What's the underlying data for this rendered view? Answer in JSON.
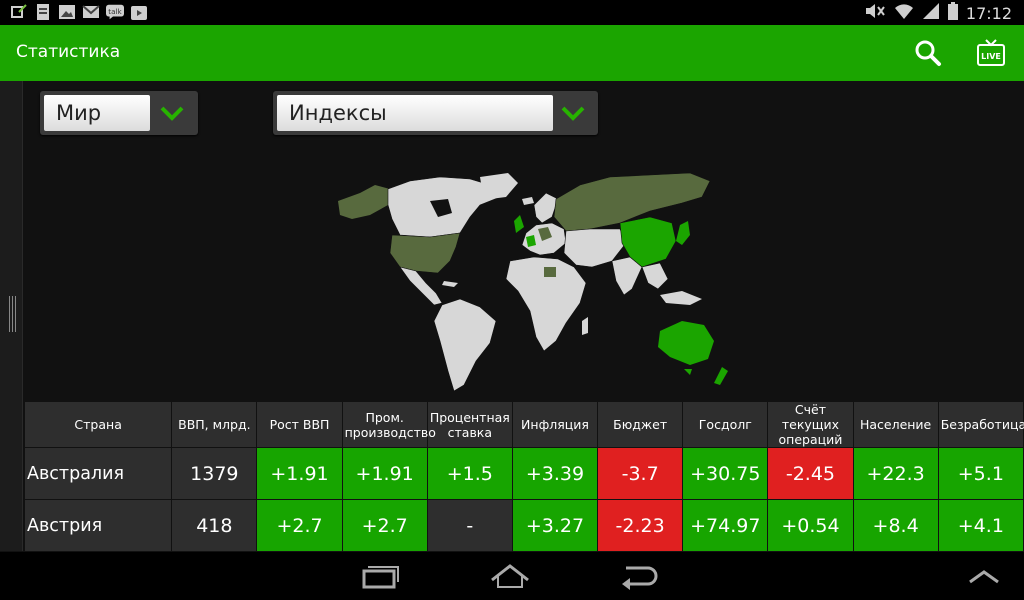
{
  "status_bar": {
    "time": "17:12",
    "left_icons": [
      "usb-icon",
      "document-icon",
      "image-icon",
      "mail-icon",
      "talk-icon",
      "play-store-icon"
    ],
    "talk_label": "talk",
    "right_icons": [
      "mute-icon",
      "wifi-icon",
      "signal-icon",
      "battery-icon"
    ]
  },
  "action_bar": {
    "title": "Статистика",
    "color": "#1ba500",
    "actions": [
      "search-icon",
      "live-tv-icon"
    ],
    "live_label": "LIVE"
  },
  "filters": {
    "region": {
      "selected": "Мир"
    },
    "category": {
      "selected": "Индексы"
    }
  },
  "map": {
    "highlight_colors": {
      "strong": "#1ba500",
      "muted": "#586a3e",
      "none": "#d7d7d7"
    }
  },
  "table": {
    "columns": [
      "Страна",
      "ВВП, млрд.",
      "Рост ВВП",
      "Пром. производство",
      "Процентная ставка",
      "Инфляция",
      "Бюджет",
      "Госдолг",
      "Счёт текущих операций",
      "Население",
      "Безработица"
    ],
    "rows": [
      {
        "cells": [
          "Австралия",
          "1379",
          "+1.91",
          "+1.91",
          "+1.5",
          "+3.39",
          "-3.7",
          "+30.75",
          "-2.45",
          "+22.3",
          "+5.1"
        ]
      },
      {
        "cells": [
          "Австрия",
          "418",
          "+2.7",
          "+2.7",
          "-",
          "+3.27",
          "-2.23",
          "+74.97",
          "+0.54",
          "+8.4",
          "+4.1"
        ]
      }
    ],
    "colors": {
      "positive": "#17a500",
      "negative": "#e02020",
      "neutral": "#2e2e2e"
    }
  },
  "nav_bar": {
    "buttons": [
      "recent-apps-icon",
      "home-icon",
      "back-icon",
      "expand-up-icon"
    ]
  }
}
